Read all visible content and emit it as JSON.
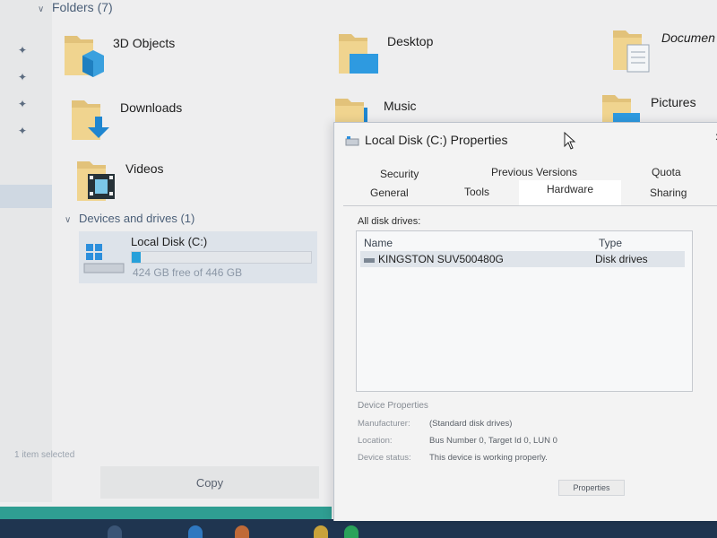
{
  "explorer": {
    "folders_header": "Folders (7)",
    "folders": [
      {
        "label": "3D Objects",
        "icon": "3d-objects-folder-icon"
      },
      {
        "label": "Desktop",
        "icon": "desktop-folder-icon"
      },
      {
        "label": "Documen",
        "icon": "documents-folder-icon"
      },
      {
        "label": "Downloads",
        "icon": "downloads-folder-icon"
      },
      {
        "label": "Music",
        "icon": "music-folder-icon"
      },
      {
        "label": "Pictures",
        "icon": "pictures-folder-icon"
      },
      {
        "label": "Videos",
        "icon": "videos-folder-icon"
      }
    ],
    "devices_header": "Devices and drives (1)",
    "drive": {
      "name": "Local Disk (C:)",
      "free_text": "424 GB free of 446 GB",
      "used_fraction": 0.05
    },
    "status": "1 item selected",
    "copy_label": "Copy"
  },
  "dialog": {
    "title": "Local Disk (C:) Properties",
    "close": "×",
    "tabs": {
      "security": "Security",
      "previous_versions": "Previous Versions",
      "quota": "Quota",
      "general": "General",
      "tools": "Tools",
      "hardware": "Hardware",
      "sharing": "Sharing"
    },
    "all_disk_drives_label": "All disk drives:",
    "columns": {
      "name": "Name",
      "type": "Type"
    },
    "rows": [
      {
        "name": "KINGSTON SUV500480G",
        "type": "Disk drives"
      }
    ],
    "device_properties": {
      "title": "Device Properties",
      "manufacturer_label": "Manufacturer:",
      "manufacturer_value": "(Standard disk drives)",
      "location_label": "Location:",
      "location_value": "Bus Number 0, Target Id 0, LUN 0",
      "status_label": "Device status:",
      "status_value": "This device is working properly."
    },
    "properties_button": "Properties"
  },
  "colors": {
    "accent": "#26a0da",
    "taskbar": "#1f3550",
    "taskbar_accent": "#2f9e92",
    "selection": "#dfe4ea"
  }
}
